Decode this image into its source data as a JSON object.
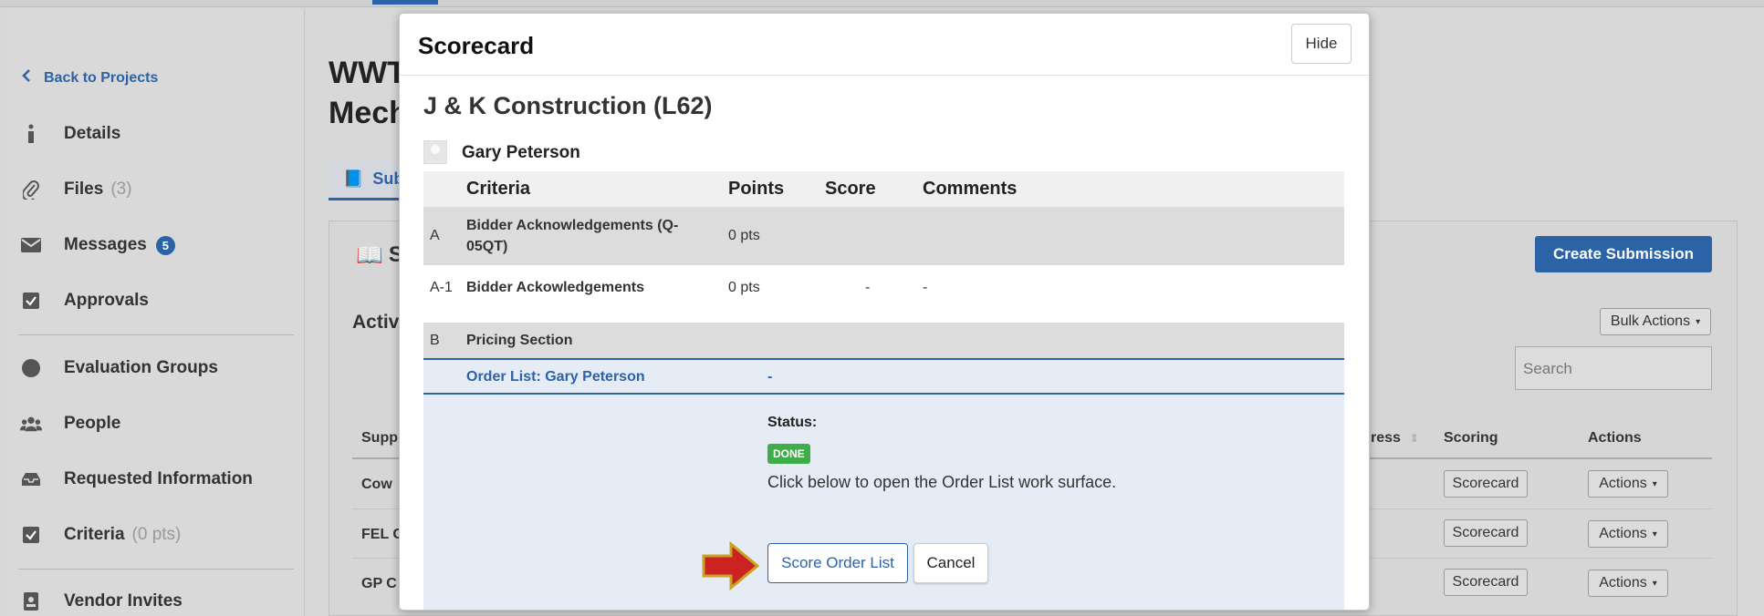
{
  "sidebar": {
    "back": "Back to Projects",
    "items": [
      {
        "label": "Details",
        "icon": "info-icon"
      },
      {
        "label": "Files",
        "count": "(3)",
        "icon": "paperclip-icon"
      },
      {
        "label": "Messages",
        "badge": "5",
        "icon": "envelope-icon"
      },
      {
        "label": "Approvals",
        "icon": "checkbox-icon"
      },
      {
        "label": "Evaluation Groups",
        "icon": "circle-icon"
      },
      {
        "label": "People",
        "icon": "users-icon"
      },
      {
        "label": "Requested Information",
        "icon": "inbox-icon"
      },
      {
        "label": "Criteria",
        "count": "(0 pts)",
        "icon": "checkbox-icon"
      },
      {
        "label": "Vendor Invites",
        "icon": "contact-card-icon"
      }
    ]
  },
  "page": {
    "title_line1": "WWT",
    "title_line2": "Mech",
    "tab_label": "Sub",
    "panel_title": "S",
    "section_title": "Activ",
    "create_button": "Create Submission",
    "bulk_actions": "Bulk Actions",
    "search_placeholder": "Search",
    "columns": {
      "supplier": "Supp",
      "progress": "ress",
      "scoring": "Scoring",
      "actions": "Actions"
    },
    "rows": [
      {
        "supplier": "Cow",
        "scoring": "Scorecard",
        "actions": "Actions"
      },
      {
        "supplier": "FEL C",
        "scoring": "Scorecard",
        "actions": "Actions"
      },
      {
        "supplier": "GP C",
        "scoring": "Scorecard",
        "actions": "Actions"
      }
    ]
  },
  "modal": {
    "title": "Scorecard",
    "hide": "Hide",
    "vendor": "J & K Construction (L62)",
    "person": "Gary Peterson",
    "headers": {
      "criteria": "Criteria",
      "points": "Points",
      "score": "Score",
      "comments": "Comments"
    },
    "rows": [
      {
        "code": "A",
        "name": "Bidder Acknowledgements (Q-05QT)",
        "name_line1": "Bidder Acknowledgements (Q-",
        "name_line2": "05QT)",
        "points": "0 pts"
      },
      {
        "code": "A-1",
        "name": "Bidder Ackowledgements",
        "points": "0 pts",
        "score": "-",
        "comment": "-"
      },
      {
        "code": "B",
        "name": "Pricing Section"
      }
    ],
    "order_list": {
      "name": "Order List: Gary Peterson",
      "score": "-",
      "status_label": "Status:",
      "status_badge": "DONE",
      "instruction": "Click below to open the Order List work surface.",
      "score_button": "Score Order List",
      "cancel_button": "Cancel"
    }
  },
  "colors": {
    "accent": "#2b63a6",
    "done": "#3fae4a",
    "arrow": "#cc2222",
    "arrow_border": "#c9a227"
  }
}
